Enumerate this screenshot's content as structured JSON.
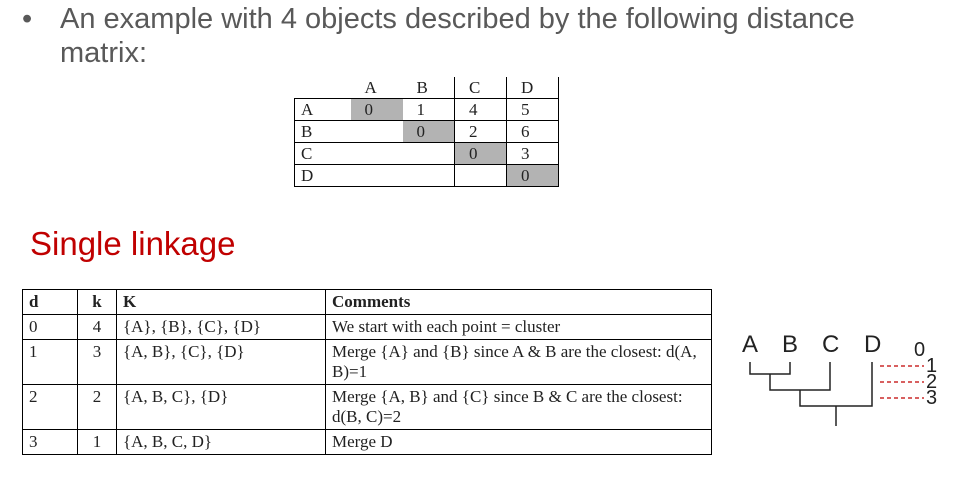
{
  "bullet": {
    "marker": "•",
    "text": "An example with 4 objects described by the following distance matrix:"
  },
  "matrix": {
    "columns": [
      "A",
      "B",
      "C",
      "D"
    ],
    "rows": [
      {
        "label": "A",
        "values": [
          "0",
          "1",
          "4",
          "5"
        ]
      },
      {
        "label": "B",
        "values": [
          "",
          "0",
          "2",
          "6"
        ]
      },
      {
        "label": "C",
        "values": [
          "",
          "",
          "0",
          "3"
        ]
      },
      {
        "label": "D",
        "values": [
          "",
          "",
          "",
          "0"
        ]
      }
    ],
    "shade_color": "#b3b3b3"
  },
  "section_title": "Single linkage",
  "steps_table": {
    "headers": [
      "d",
      "k",
      "K",
      "Comments"
    ],
    "rows": [
      {
        "d": "0",
        "k": "4",
        "K": "{A}, {B}, {C}, {D}",
        "comment": "We start with each point = cluster"
      },
      {
        "d": "1",
        "k": "3",
        "K": "{A, B}, {C}, {D}",
        "comment": "Merge {A} and {B} since A & B are the closest: d(A, B)=1"
      },
      {
        "d": "2",
        "k": "2",
        "K": "{A, B, C}, {D}",
        "comment": "Merge {A, B} and {C} since B & C are the closest: d(B, C)=2"
      },
      {
        "d": "3",
        "k": "1",
        "K": "{A, B, C, D}",
        "comment": "Merge D"
      }
    ]
  },
  "dendrogram": {
    "leaves": [
      "A",
      "B",
      "C",
      "D"
    ],
    "levels": [
      "0",
      "1",
      "2",
      "3"
    ],
    "level_line_color": "#c00000"
  }
}
